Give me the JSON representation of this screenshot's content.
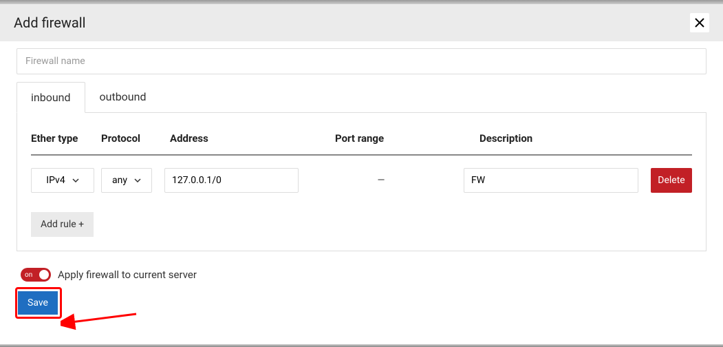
{
  "header": {
    "title": "Add firewall"
  },
  "form": {
    "name_placeholder": "Firewall name"
  },
  "tabs": {
    "inbound": "inbound",
    "outbound": "outbound"
  },
  "table": {
    "headers": {
      "ether": "Ether type",
      "protocol": "Protocol",
      "address": "Address",
      "port": "Port range",
      "description": "Description"
    },
    "rows": [
      {
        "ether": "IPv4",
        "protocol": "any",
        "address": "127.0.0.1/0",
        "port": "—",
        "description": "FW"
      }
    ],
    "delete_label": "Delete",
    "add_rule_label": "Add rule +"
  },
  "toggle": {
    "state_label": "on",
    "text": "Apply firewall to current server"
  },
  "save_label": "Save"
}
